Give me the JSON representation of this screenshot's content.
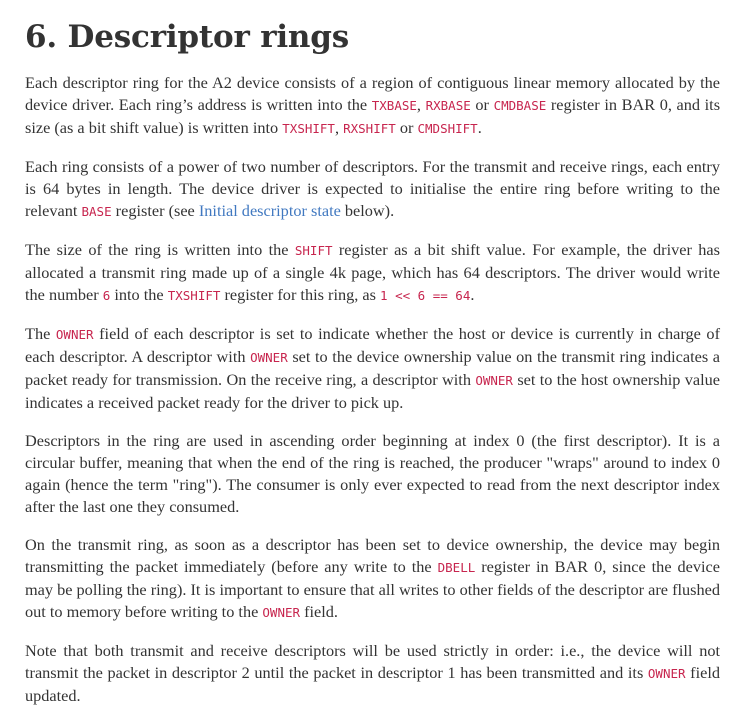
{
  "heading": "6. Descriptor rings",
  "p1": {
    "t1": "Each descriptor ring for the A2 device consists of a region of contiguous linear memory allocated by the device driver. Each ring’s address is written into the ",
    "c1": "TXBASE",
    "t2": ", ",
    "c2": "RXBASE",
    "t3": " or ",
    "c3": "CMDBASE",
    "t4": " register in BAR 0, and its size (as a bit shift value) is written into ",
    "c4": "TXSHIFT",
    "t5": ", ",
    "c5": "RXSHIFT",
    "t6": " or ",
    "c6": "CMDSHIFT",
    "t7": "."
  },
  "p2": {
    "t1": "Each ring consists of a power of two number of descriptors. For the transmit and receive rings, each entry is 64 bytes in length. The device driver is expected to initialise the entire ring before writing to the relevant ",
    "c1": "BASE",
    "t2": " register (see ",
    "link": "Initial descriptor state",
    "t3": " below)."
  },
  "p3": {
    "t1": "The size of the ring is written into the ",
    "c1": "SHIFT",
    "t2": " register as a bit shift value. For example, the driver has allocated a transmit ring made up of a single 4k page, which has 64 descriptors. The driver would write the number ",
    "c2": "6",
    "t3": " into the ",
    "c3": "TXSHIFT",
    "t4": " register for this ring, as ",
    "c4": "1 << 6 == 64",
    "t5": "."
  },
  "p4": {
    "t1": "The ",
    "c1": "OWNER",
    "t2": " field of each descriptor is set to indicate whether the host or device is currently in charge of each descriptor. A descriptor with ",
    "c2": "OWNER",
    "t3": " set to the device ownership value on the transmit ring indicates a packet ready for transmission. On the receive ring, a descriptor with ",
    "c3": "OWNER",
    "t4": " set to the host ownership value indicates a received packet ready for the driver to pick up."
  },
  "p5": {
    "t1": "Descriptors in the ring are used in ascending order beginning at index 0 (the first descriptor). It is a circular buffer, meaning that when the end of the ring is reached, the producer \"wraps\" around to index 0 again (hence the term \"ring\"). The consumer is only ever expected to read from the next descriptor index after the last one they consumed."
  },
  "p6": {
    "t1": "On the transmit ring, as soon as a descriptor has been set to device ownership, the device may begin transmitting the packet immediately (before any write to the ",
    "c1": "DBELL",
    "t2": " register in BAR 0, since the device may be polling the ring). It is important to ensure that all writes to other fields of the descriptor are flushed out to memory before writing to the ",
    "c2": "OWNER",
    "t3": " field."
  },
  "p7": {
    "t1": "Note that both transmit and receive descriptors will be used strictly in order: i.e., the device will not transmit the packet in descriptor 2 until the packet in descriptor 1 has been transmitted and its ",
    "c1": "OWNER",
    "t2": " field updated."
  },
  "colors": {
    "text": "#333333",
    "code": "#c7254e",
    "link": "#4078c0"
  }
}
